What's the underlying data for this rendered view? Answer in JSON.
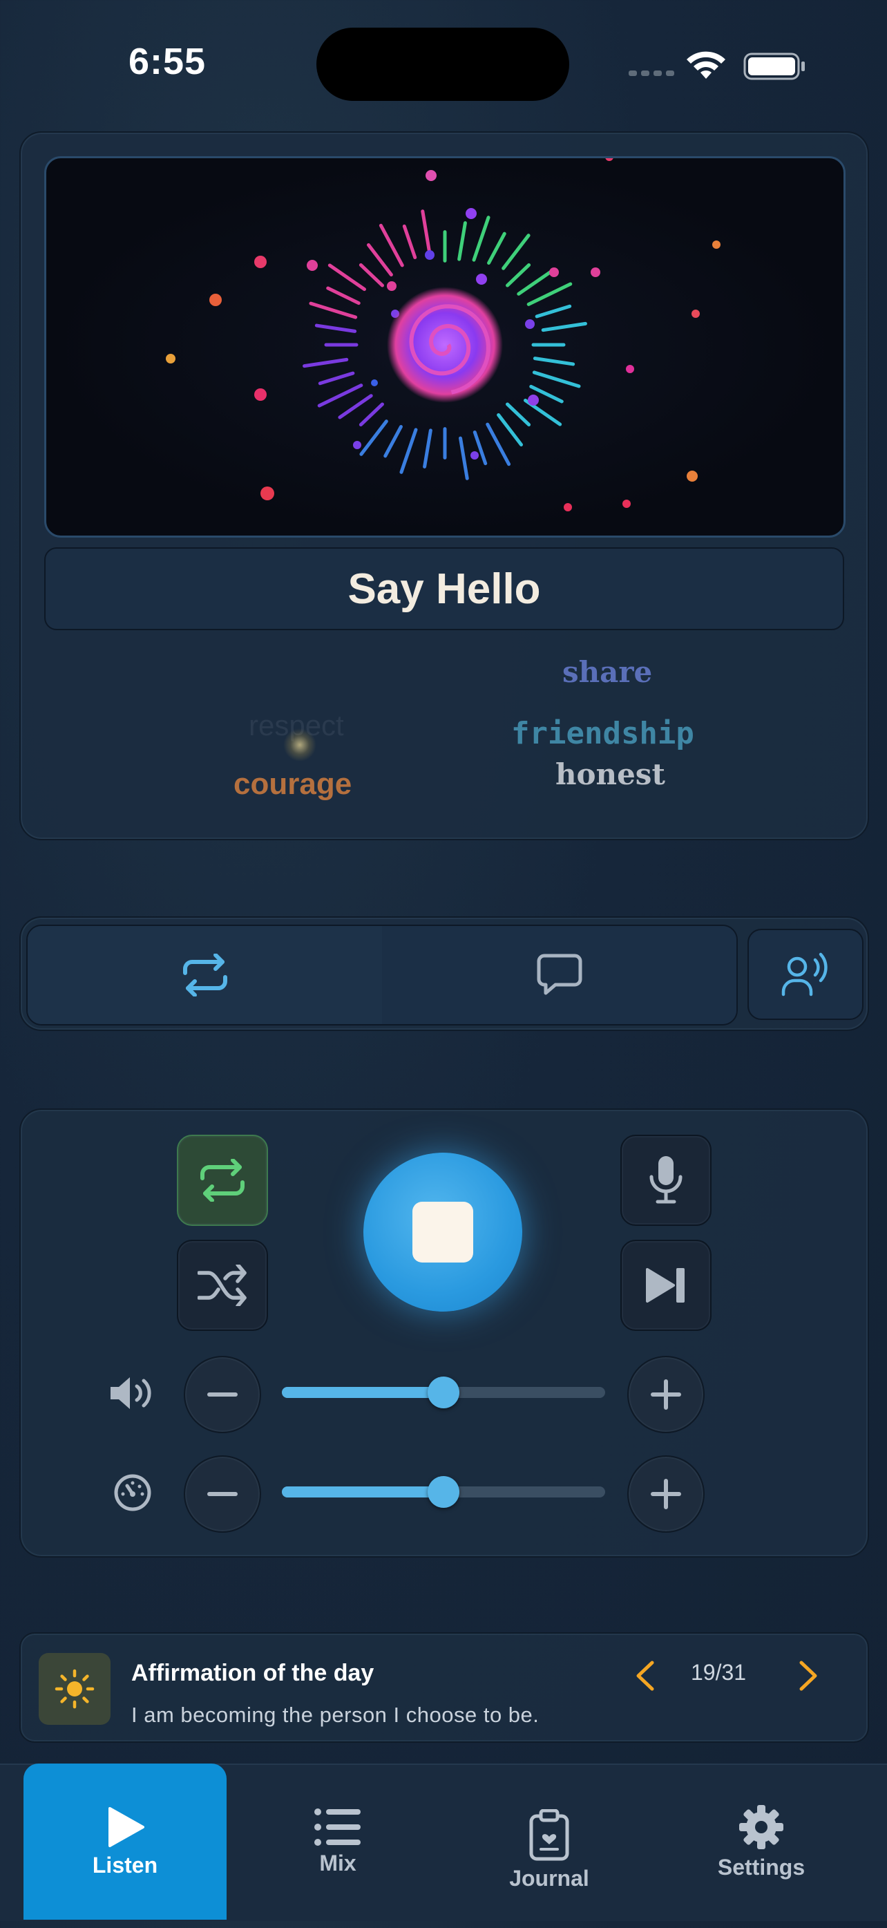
{
  "status": {
    "time": "6:55"
  },
  "visualizer": {
    "title": "Say Hello"
  },
  "word_cloud": {
    "words": [
      "share",
      "respect",
      "friendship",
      "courage",
      "honest"
    ]
  },
  "mode_tabs": {
    "repeat_icon": "repeat-icon",
    "chat_icon": "chat-bubble-icon",
    "voice_icon": "speaking-person-icon"
  },
  "controls": {
    "volume_level": 0.5,
    "speed_level": 0.5
  },
  "affirmation": {
    "title": "Affirmation of the day",
    "text": "I am becoming the person I choose to be.",
    "counter": "19/31"
  },
  "tabbar": {
    "tabs": [
      {
        "label": "Listen",
        "icon": "play-icon",
        "active": true
      },
      {
        "label": "Mix",
        "icon": "list-icon",
        "active": false
      },
      {
        "label": "Journal",
        "icon": "clipboard-heart-icon",
        "active": false
      },
      {
        "label": "Settings",
        "icon": "gear-icon",
        "active": false
      }
    ]
  },
  "colors": {
    "accent": "#0d8fd6",
    "slider": "#56b5e8",
    "arrow": "#f5a623",
    "repeat_on": "#3e7a4e"
  }
}
